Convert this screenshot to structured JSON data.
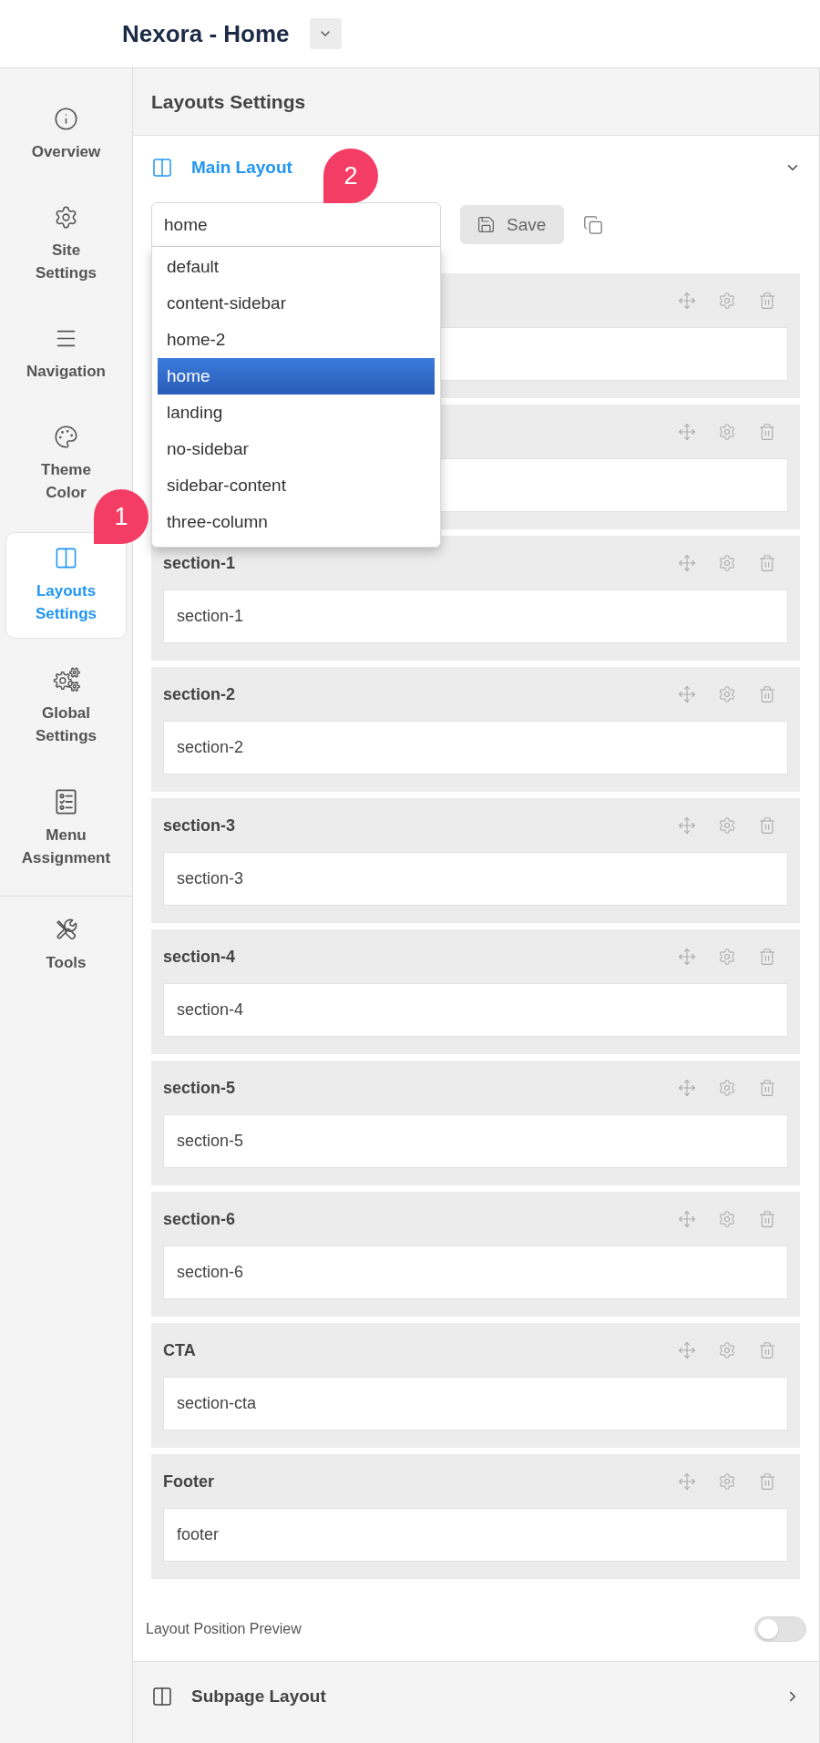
{
  "header": {
    "title": "Nexora - Home"
  },
  "sidebar": {
    "groups": [
      {
        "items": [
          {
            "label": "Overview",
            "selected": false
          },
          {
            "label": "Site Settings",
            "selected": false
          },
          {
            "label": "Navigation",
            "selected": false
          },
          {
            "label": "Theme Color",
            "selected": false
          },
          {
            "label": "Layouts Settings",
            "selected": true
          },
          {
            "label": "Global Settings",
            "selected": false
          },
          {
            "label": "Menu Assignment",
            "selected": false
          }
        ]
      },
      {
        "items": [
          {
            "label": "Tools",
            "selected": false
          }
        ]
      }
    ]
  },
  "panel": {
    "title": "Layouts Settings",
    "sections": [
      {
        "title": "Main Layout",
        "expanded": true,
        "layout_select": {
          "value": "home",
          "options": [
            {
              "label": "default",
              "selected": false
            },
            {
              "label": "content-sidebar",
              "selected": false
            },
            {
              "label": "home-2",
              "selected": false
            },
            {
              "label": "home",
              "selected": true
            },
            {
              "label": "landing",
              "selected": false
            },
            {
              "label": "no-sidebar",
              "selected": false
            },
            {
              "label": "sidebar-content",
              "selected": false
            },
            {
              "label": "three-column",
              "selected": false
            }
          ]
        },
        "save_button": "Save",
        "blocks": [
          {
            "kind": "covered"
          },
          {
            "kind": "covered"
          },
          {
            "kind": "section",
            "title": "section-1",
            "value": "section-1"
          },
          {
            "kind": "section",
            "title": "section-2",
            "value": "section-2"
          },
          {
            "kind": "section",
            "title": "section-3",
            "value": "section-3"
          },
          {
            "kind": "section",
            "title": "section-4",
            "value": "section-4"
          },
          {
            "kind": "section",
            "title": "section-5",
            "value": "section-5"
          },
          {
            "kind": "section",
            "title": "section-6",
            "value": "section-6"
          },
          {
            "kind": "section",
            "title": "CTA",
            "value": "section-cta"
          },
          {
            "kind": "section",
            "title": "Footer",
            "value": "footer"
          }
        ],
        "preview_toggle": {
          "label": "Layout Position Preview",
          "on": false
        }
      },
      {
        "title": "Subpage Layout",
        "expanded": false
      }
    ]
  },
  "callouts": [
    {
      "label": "1"
    },
    {
      "label": "2"
    }
  ]
}
